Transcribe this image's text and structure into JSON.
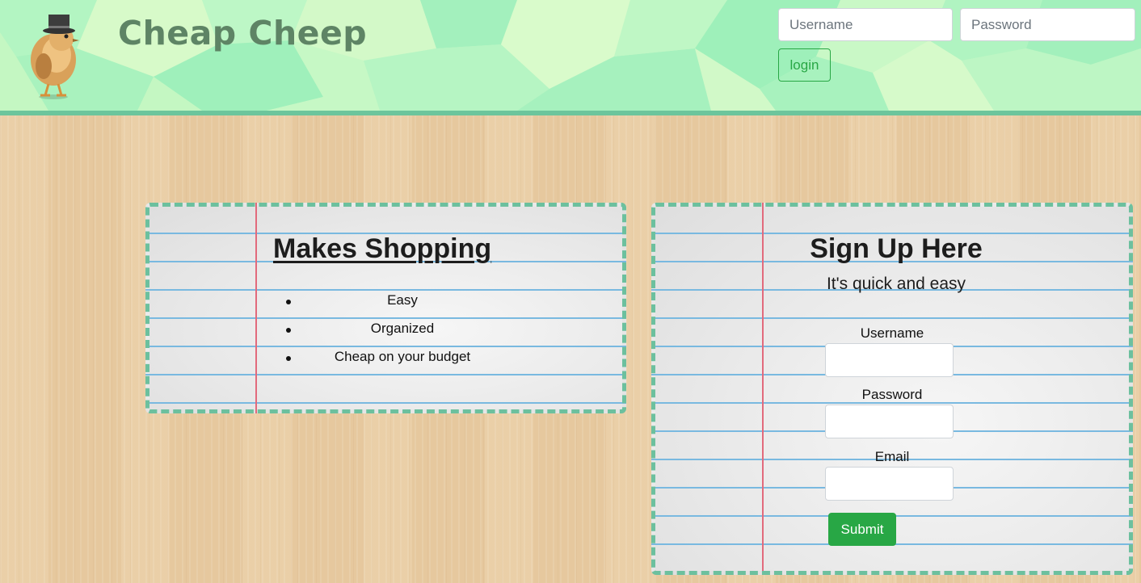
{
  "header": {
    "brand": "Cheap Cheep",
    "username_placeholder": "Username",
    "password_placeholder": "Password",
    "login_label": "login"
  },
  "features_card": {
    "title": "Makes Shopping",
    "items": [
      "Easy",
      "Organized",
      "Cheap on your budget"
    ]
  },
  "signup_card": {
    "title": "Sign Up Here",
    "subtitle": "It's quick and easy",
    "fields": {
      "username_label": "Username",
      "password_label": "Password",
      "email_label": "Email"
    },
    "submit_label": "Submit"
  },
  "colors": {
    "header_bg": "#c4f7c2",
    "header_border": "#6cc59c",
    "brand_text": "#5e8465",
    "card_border": "#6cc09e",
    "success": "#28a745"
  }
}
